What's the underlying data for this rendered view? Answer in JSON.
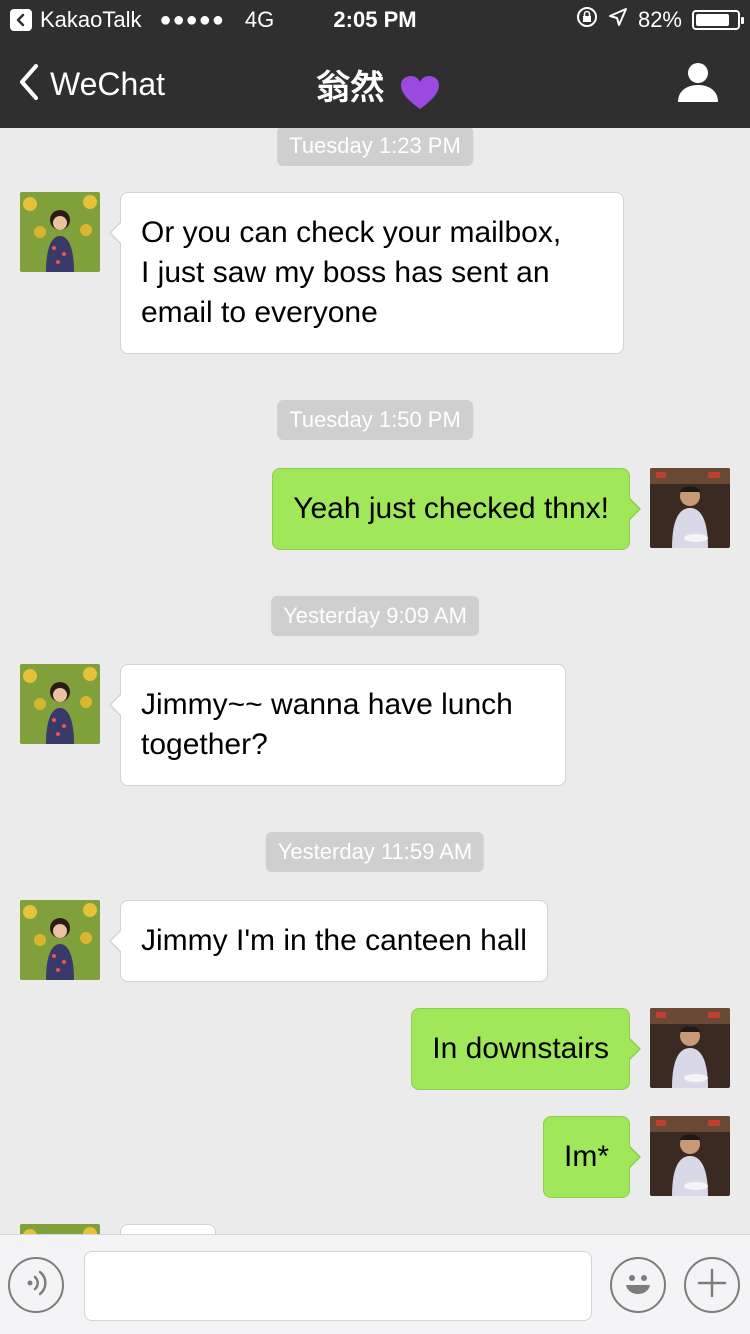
{
  "status_bar": {
    "back_app": "KakaoTalk",
    "signal_dots": "●●●●●",
    "network": "4G",
    "time": "2:05 PM",
    "battery": "82%",
    "battery_level": 0.82
  },
  "nav": {
    "back_label": "WeChat",
    "title": "翁然"
  },
  "messages": {
    "ts1": "Tuesday 1:23 PM",
    "m1": "Or you can check your mailbox,\nI just saw my boss has sent an\nemail to everyone",
    "ts2": "Tuesday 1:50 PM",
    "m2": "Yeah just checked thnx!",
    "ts3": "Yesterday 9:09 AM",
    "m3": "Jimmy~~ wanna have lunch\ntogether?",
    "ts4": "Yesterday 11:59 AM",
    "m4": "Jimmy I'm in the canteen hall",
    "m5": "In downstairs",
    "m6": "Im*"
  },
  "colors": {
    "bar_bg": "#2f2f2f",
    "chat_bg": "#ebebeb",
    "bubble_in": "#ffffff",
    "bubble_out": "#a0e75a",
    "timestamp_bg": "#cfcfcf"
  },
  "icons": {
    "nav_back": "chevron-left-icon",
    "profile": "person-icon",
    "voice": "voice-icon",
    "emoji": "smiley-icon",
    "more": "plus-icon",
    "heart": "purple-heart-icon"
  }
}
